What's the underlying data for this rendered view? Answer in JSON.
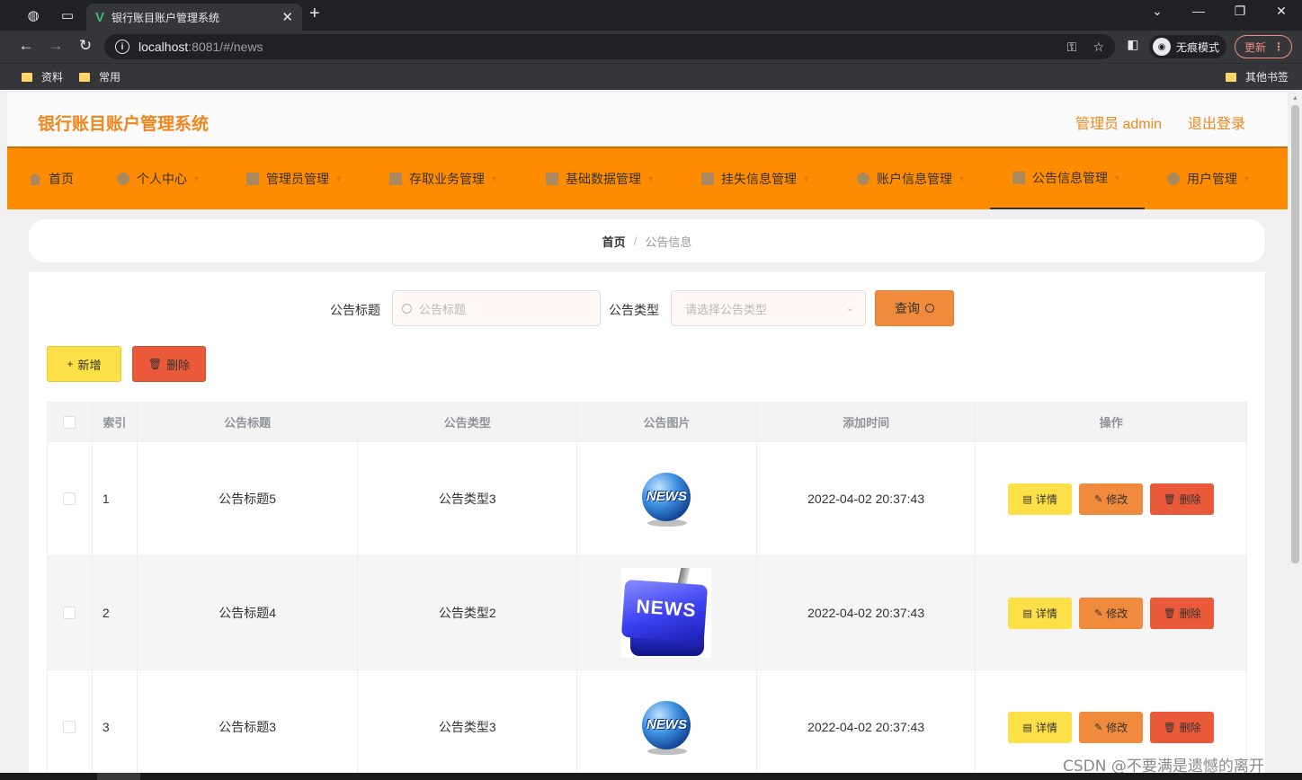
{
  "browser": {
    "tab_title": "银行账目账户管理系统",
    "url_host": "localhost",
    "url_path": ":8081/#/news",
    "incognito_label": "无痕模式",
    "update_label": "更新",
    "bookmarks": [
      "资料",
      "常用"
    ],
    "other_bookmarks": "其他书签"
  },
  "header": {
    "title": "银行账目账户管理系统",
    "user": "管理员 admin",
    "logout": "退出登录"
  },
  "menu": [
    {
      "label": "首页",
      "icon": "home-icon"
    },
    {
      "label": "个人中心",
      "icon": "user-icon"
    },
    {
      "label": "管理员管理",
      "icon": "admin-icon"
    },
    {
      "label": "存取业务管理",
      "icon": "video-icon"
    },
    {
      "label": "基础数据管理",
      "icon": "clipboard-icon"
    },
    {
      "label": "挂失信息管理",
      "icon": "copy-icon"
    },
    {
      "label": "账户信息管理",
      "icon": "target-icon"
    },
    {
      "label": "公告信息管理",
      "icon": "grid-icon",
      "active": true
    },
    {
      "label": "用户管理",
      "icon": "compass-icon"
    }
  ],
  "breadcrumb": {
    "home": "首页",
    "separator": "/",
    "current": "公告信息"
  },
  "search": {
    "title_label": "公告标题",
    "title_placeholder": "公告标题",
    "type_label": "公告类型",
    "type_placeholder": "请选择公告类型",
    "query_label": "查询"
  },
  "actions": {
    "add_label": "新增",
    "delete_label": "删除"
  },
  "table": {
    "columns": [
      "索引",
      "公告标题",
      "公告类型",
      "公告图片",
      "添加时间",
      "操作"
    ],
    "rows": [
      {
        "index": "1",
        "title": "公告标题5",
        "type": "公告类型3",
        "image": "globe",
        "image_text": "NEWS",
        "time": "2022-04-02 20:37:43"
      },
      {
        "index": "2",
        "title": "公告标题4",
        "type": "公告类型2",
        "image": "key",
        "image_text": "NEWS",
        "time": "2022-04-02 20:37:43"
      },
      {
        "index": "3",
        "title": "公告标题3",
        "type": "公告类型3",
        "image": "globe",
        "image_text": "NEWS",
        "time": "2022-04-02 20:37:43"
      }
    ],
    "op_labels": {
      "detail": "详情",
      "edit": "修改",
      "delete": "删除"
    }
  },
  "watermark": "CSDN @不要满是遗憾的离开",
  "colors": {
    "brand": "#ff8c00",
    "title": "#f0851d",
    "detail": "#fde047",
    "edit": "#f08a3c",
    "delete": "#ea5a3a"
  }
}
